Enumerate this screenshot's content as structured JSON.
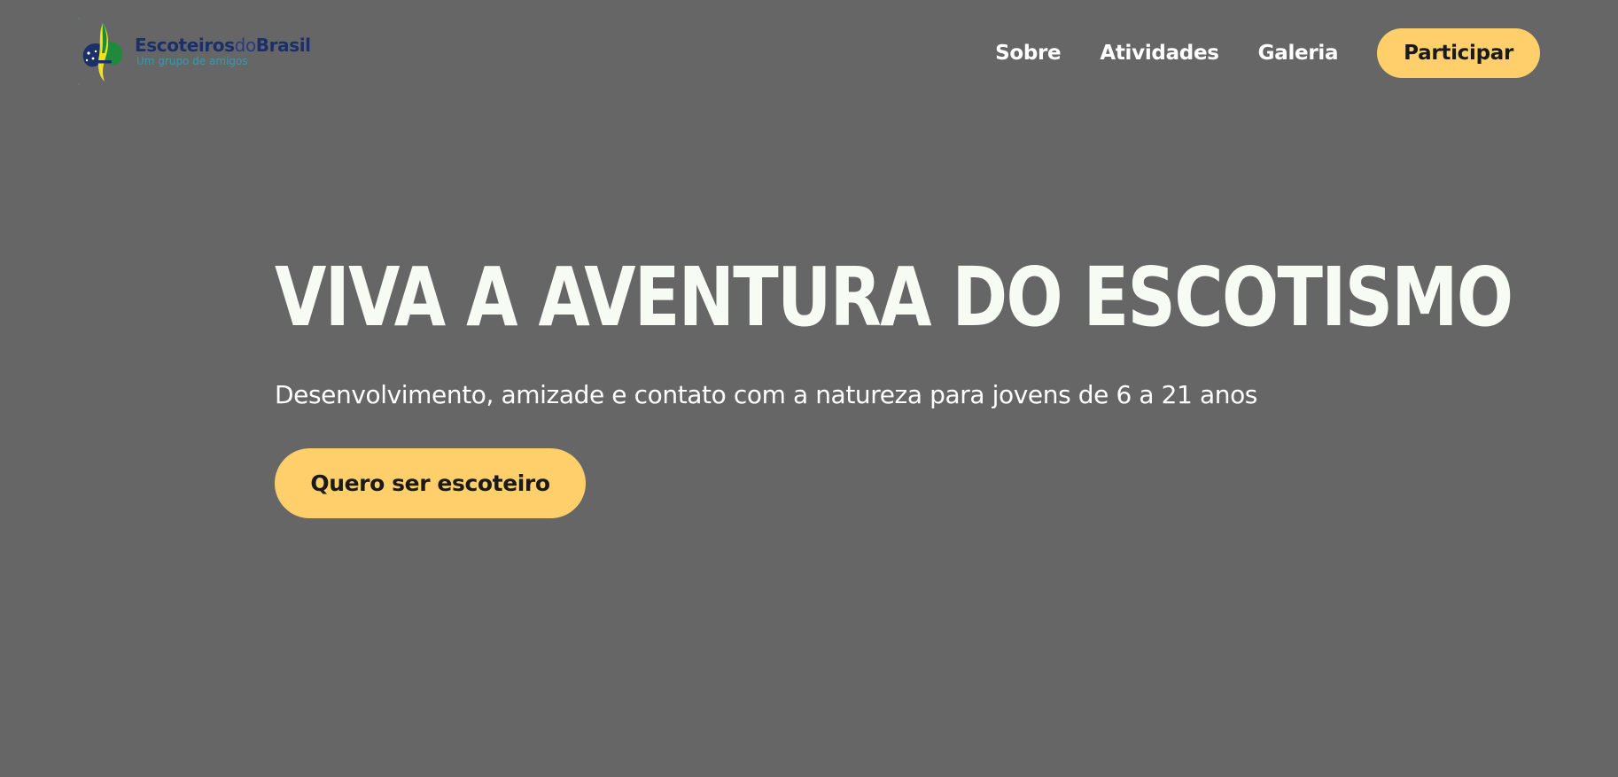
{
  "colors": {
    "background": "#666666",
    "accent": "#ffcf6b",
    "hero_title": "#f6fbf4",
    "logo_navy": "#1b2f6b",
    "logo_teal": "#2f9bb5",
    "logo_green": "#1f8a3b",
    "logo_yellow": "#f2e21b"
  },
  "header": {
    "logo": {
      "brand_part1": "Escoteiros",
      "brand_part2": "do",
      "brand_part3": "Brasil",
      "tagline": "Um grupo de amigos",
      "icon": "fleur-de-lis-icon"
    },
    "nav": {
      "links": [
        {
          "label": "Sobre"
        },
        {
          "label": "Atividades"
        },
        {
          "label": "Galeria"
        }
      ],
      "cta_label": "Participar"
    }
  },
  "hero": {
    "title": "VIVA A AVENTURA DO ESCOTISMO",
    "subtitle": "Desenvolvimento, amizade e contato com a natureza para jovens de 6 a 21 anos",
    "cta_label": "Quero ser escoteiro"
  }
}
